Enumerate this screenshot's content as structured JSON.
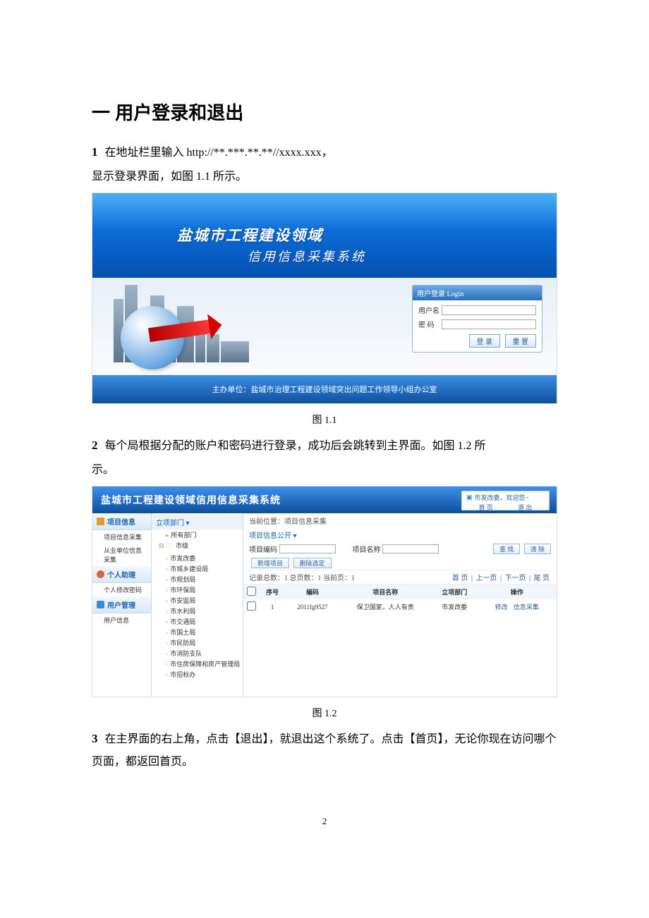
{
  "heading": "一  用户登录和退出",
  "step1": {
    "num": "1",
    "text_a": "在地址栏里输入 http://**.***.**.**//xxxx.xxx，",
    "text_b": "显示登录界面，如图 1.1 所示。"
  },
  "fig1": {
    "title_line1": "盐城市工程建设领域",
    "title_line2": "信用信息采集系统",
    "login_head": "用户登录  Login",
    "username_lbl": "用户名",
    "password_lbl": "密  码",
    "btn_login": "登 录",
    "btn_reset": "重 置",
    "footer": "主办单位：盐城市治理工程建设领域突出问题工作领导小组办公室",
    "caption": "图 1.1"
  },
  "step2": {
    "num": "2",
    "text_a": "每个局根据分配的账户和密码进行登录，成功后会跳转到主界面。如图 1.2 所",
    "text_b": "示。"
  },
  "fig2": {
    "head_title": "盐城市工程建设领域信用信息采集系统",
    "userbox_welcome": "市发改委，欢迎您~",
    "userbox_home": "首 页",
    "userbox_logout": "退 出",
    "left_menu": {
      "g1": "项目信息",
      "g1a": "项目信息采集",
      "g1b": "从业单位信息采集",
      "g2": "个人助理",
      "g2a": "个人修改密码",
      "g3": "用户管理",
      "g3a": "用户信息"
    },
    "tree_top": "立项部门 ▾",
    "tree": [
      "所有部门",
      "市级",
      "市发改委",
      "市城乡建设局",
      "市规划局",
      "市环保局",
      "市安监局",
      "市水利局",
      "市交通局",
      "市国土局",
      "市民防局",
      "市消防支队",
      "市住房保障和房产管理局",
      "市招标办"
    ],
    "crumb": "当前位置：项目信息采集",
    "tab": "项目信息公开 ▾",
    "filter": {
      "code": "项目编码",
      "name": "项目名称",
      "find": "查 找",
      "clear": "清 除"
    },
    "toolbar": {
      "new": "新增项目",
      "del": "删除选定"
    },
    "pager_left": "记录总数：1  总页数：1  当前页：1",
    "pager_links": [
      "首 页",
      "上一页",
      "下一页",
      "尾 页"
    ],
    "thead": {
      "chk": "",
      "idx": "序号",
      "code": "编码",
      "name": "项目名称",
      "dept": "立项部门",
      "ops": "操作"
    },
    "row": {
      "idx": "1",
      "code": "2011fg9527",
      "name": "保卫国家，人人有责",
      "dept": "市发改委",
      "op1": "修改",
      "op2": "信息采集"
    },
    "caption": "图 1.2"
  },
  "step3": {
    "num": "3",
    "text": "在主界面的右上角，点击【退出】，就退出这个系统了。点击【首页】，无论你现在访问哪个页面，都返回首页。"
  },
  "page_number": "2"
}
